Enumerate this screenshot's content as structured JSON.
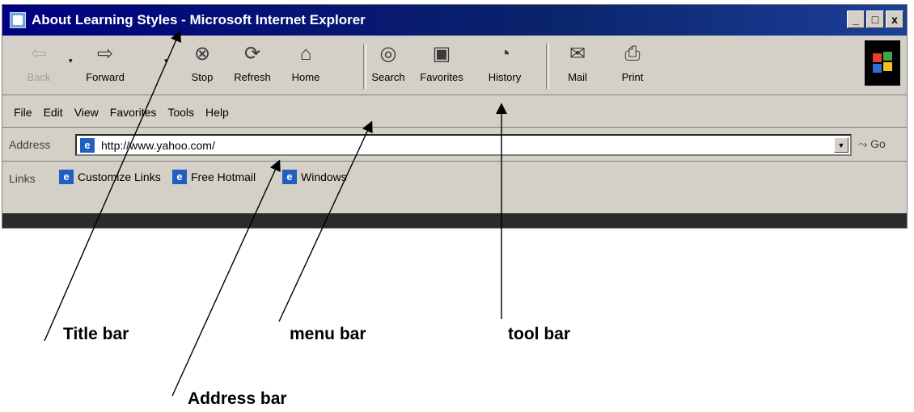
{
  "window": {
    "title": "About Learning Styles - Microsoft Internet Explorer",
    "controls": {
      "minimize": "_",
      "maximize": "□",
      "close": "x"
    }
  },
  "toolbar": {
    "buttons": [
      {
        "label": "Back",
        "icon": "back-arrow-icon",
        "glyph": "⇦",
        "disabled": true
      },
      {
        "label": "Forward",
        "icon": "forward-arrow-icon",
        "glyph": "⇨",
        "disabled": false
      },
      {
        "label": "Stop",
        "icon": "stop-icon",
        "glyph": "⊗",
        "disabled": false
      },
      {
        "label": "Refresh",
        "icon": "refresh-icon",
        "glyph": "⟳",
        "disabled": false
      },
      {
        "label": "Home",
        "icon": "home-icon",
        "glyph": "⌂",
        "disabled": false
      },
      {
        "label": "Search",
        "icon": "search-icon",
        "glyph": "◎",
        "disabled": false
      },
      {
        "label": "Favorites",
        "icon": "favorites-icon",
        "glyph": "▣",
        "disabled": false
      },
      {
        "label": "History",
        "icon": "history-icon",
        "glyph": "◔",
        "disabled": false
      },
      {
        "label": "Mail",
        "icon": "mail-icon",
        "glyph": "✉",
        "disabled": false
      },
      {
        "label": "Print",
        "icon": "print-icon",
        "glyph": "⎙",
        "disabled": false
      }
    ]
  },
  "menu": {
    "items": [
      "File",
      "Edit",
      "View",
      "Favorites",
      "Tools",
      "Help"
    ]
  },
  "address": {
    "label": "Address",
    "value": "http://www.yahoo.com/",
    "go_label": "Go"
  },
  "links": {
    "label": "Links",
    "items": [
      "Customize Links",
      "Free Hotmail",
      "Windows"
    ]
  },
  "callouts": {
    "title_bar": "Title bar",
    "menu_bar": "menu bar",
    "tool_bar": "tool bar",
    "address_bar": "Address bar"
  },
  "colors": {
    "titlebar": "#0a246a",
    "chrome": "#d4d0c8"
  }
}
